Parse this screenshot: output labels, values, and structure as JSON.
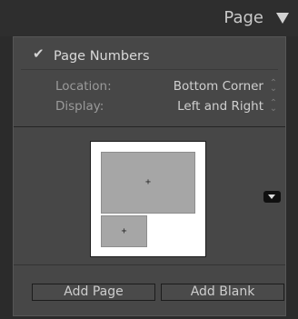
{
  "header": {
    "title": "Page",
    "collapse_icon": "triangle-down-icon"
  },
  "page_numbers": {
    "checked": true,
    "check_glyph": "✔",
    "label": "Page Numbers"
  },
  "settings": [
    {
      "label": "Location:",
      "value": "Bottom Corner"
    },
    {
      "label": "Display:",
      "value": "Left and Right"
    }
  ],
  "preview": {
    "cell_glyph": "+",
    "menu_icon": "dropdown-menu-icon"
  },
  "buttons": {
    "add_page": "Add Page",
    "add_blank": "Add Blank"
  },
  "stepper": {
    "up": "⌃",
    "down": "⌄"
  }
}
